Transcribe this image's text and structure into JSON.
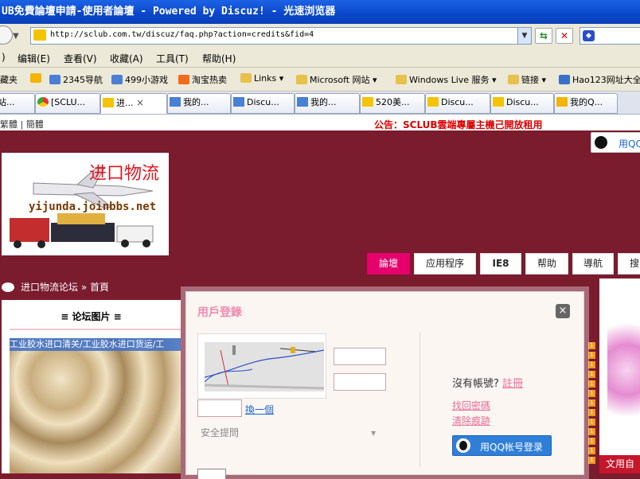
{
  "window": {
    "title": "UB免費論壇申請-使用者論壇 - Powered by Discuz! - 光速浏览器"
  },
  "address": {
    "url": "http://sclub.com.tw/discuz/faq.php?action=credits&fid=4"
  },
  "menu": [
    "编辑(E)",
    "查看(V)",
    "收藏(A)",
    "工具(T)",
    "帮助(H)"
  ],
  "menu_left_stub": ")",
  "favorites": {
    "stub": "藏夹",
    "items": [
      "2345导航",
      "499小游戏",
      "淘宝热卖",
      "Links",
      "Microsoft 网站",
      "Windows Live 服务",
      "链接",
      "Hao123网址大全"
    ]
  },
  "tabs": [
    "站...",
    "[SCLU...",
    "进...",
    "我的...",
    "Discu...",
    "我的...",
    "520美...",
    "Discu...",
    "Discu...",
    "我的Q..."
  ],
  "tab_close": "×",
  "page": {
    "lang_links": "繁體 | 簡體",
    "notice": "公告：SCLUB雲端專屬主機己開放租用",
    "qq_top": "用QQ",
    "logo_brand": "进口物流",
    "logo_url": "yijunda.joinbbs.net",
    "nav": [
      "論壇",
      "应用程序",
      "IE8",
      "帮助",
      "導航",
      "搜"
    ],
    "breadcrumb": {
      "forum": "进口物流论坛",
      "sep": "»",
      "home": "首頁"
    },
    "sidebar_title": "≡ 论坛图片 ≡",
    "sidebar_caption": "工业胶水进口清关/工业胶水进口货运/工",
    "right_ad_text": "文用自",
    "right_badges": [
      "1",
      "1",
      "1",
      "1",
      "1",
      "1",
      "1",
      "1",
      "1",
      "1",
      "1",
      "1",
      "1"
    ]
  },
  "login": {
    "title": "用戶登錄",
    "close": "×",
    "refresh": "換一個",
    "security_question": "安全提問",
    "no_account": "沒有帳號?",
    "register": "註冊",
    "forgot": "找回密碼",
    "clear": "清除痕跡",
    "qq_login": "用QQ帐号登录"
  }
}
